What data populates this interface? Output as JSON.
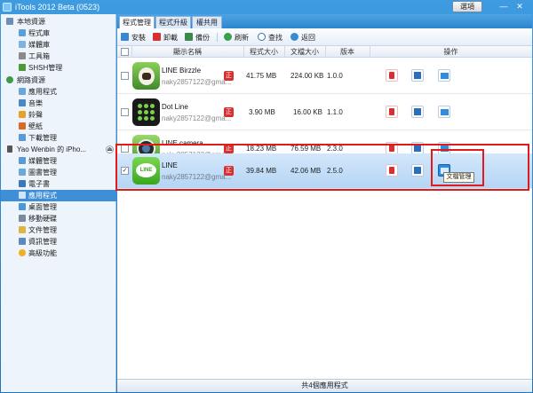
{
  "window": {
    "title": "iTools 2012 Beta (0523)",
    "options_label": "選項",
    "minimize_glyph": "—",
    "close_glyph": "✕"
  },
  "sidebar": {
    "sections": [
      {
        "label": "本地資源",
        "icon": "computer-icon",
        "children": [
          "程式庫",
          "媒體庫",
          "工具箱",
          "SHSH管理"
        ]
      },
      {
        "label": "網路資源",
        "icon": "globe-icon",
        "children": [
          "應用程式",
          "音樂",
          "鈴聲",
          "壁紙",
          "下載管理"
        ]
      },
      {
        "label": "Yao Wenbin 的 iPho...",
        "icon": "iphone-icon",
        "children": [
          "媒體管理",
          "圖書管理",
          "電子書",
          "應用程式",
          "桌面管理",
          "移動硬碟",
          "文件管理",
          "資訊管理",
          "高級功能"
        ]
      }
    ],
    "selected": "應用程式"
  },
  "tabs": [
    "程式管理",
    "程式升級",
    "權共用"
  ],
  "toolbar": {
    "install": "安裝",
    "uninstall": "卸載",
    "backup": "備份",
    "refresh": "刷新",
    "search": "查找",
    "back": "返回"
  },
  "table": {
    "headers": [
      "顯示名稱",
      "程式大小",
      "文檔大小",
      "版本",
      "操作"
    ],
    "rows": [
      {
        "name": "LINE Birzzle",
        "author": "naky2857122@gma...",
        "badge": "正",
        "app_size": "41.75 MB",
        "doc_size": "224.00 KB",
        "version": "1.0.0",
        "selected": false
      },
      {
        "name": "Dot Line",
        "author": "naky2857122@gma...",
        "badge": "正",
        "app_size": "3.90 MB",
        "doc_size": "16.00 KB",
        "version": "1.1.0",
        "selected": false
      },
      {
        "name": "LINE camera",
        "author": "naky2857122@gma...",
        "badge": "正",
        "app_size": "18.23 MB",
        "doc_size": "76.59 MB",
        "version": "2.3.0",
        "selected": false
      },
      {
        "name": "LINE",
        "author": "naky2857122@gma...",
        "badge": "正",
        "app_size": "39.84 MB",
        "doc_size": "42.06 MB",
        "version": "2.5.0",
        "selected": true
      }
    ],
    "checkmark": "✓"
  },
  "tooltip": "文檔管理",
  "status": "共4個應用程式",
  "line_icon_text": "LINE",
  "colors": {
    "accent": "#3f8ed8",
    "highlight": "#e01b1b",
    "delete": "#d83030",
    "save": "#2c6fb8",
    "folder": "#2f8de0"
  }
}
